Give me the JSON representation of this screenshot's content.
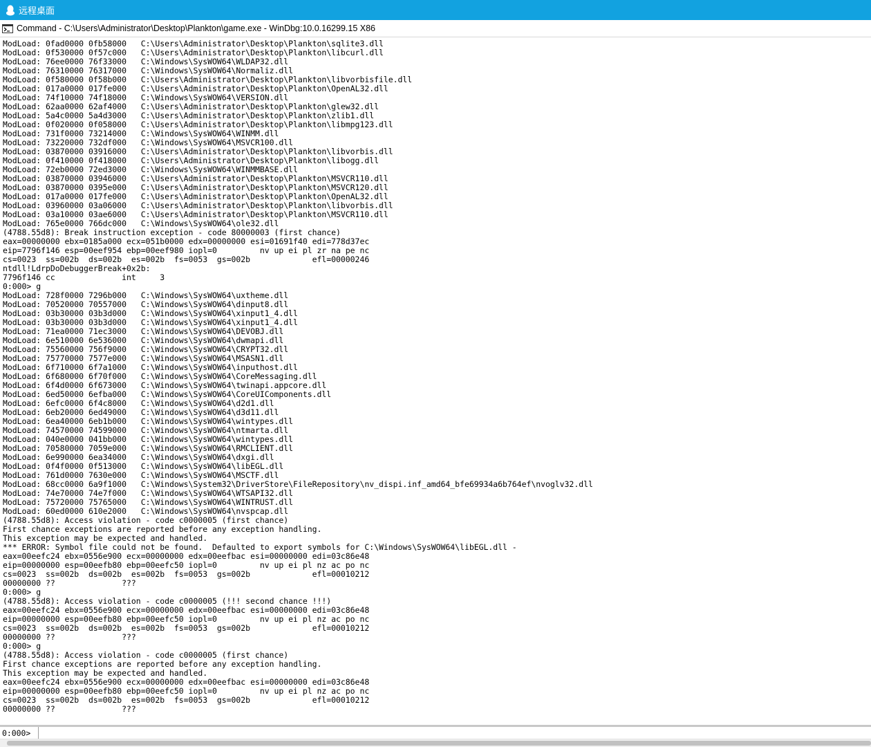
{
  "remote_desktop": {
    "title": "远程桌面"
  },
  "command_window": {
    "title": "Command - C:\\Users\\Administrator\\Desktop\\Plankton\\game.exe - WinDbg:10.0.16299.15 X86"
  },
  "output_lines": [
    "ModLoad: 0fad0000 0fb58000   C:\\Users\\Administrator\\Desktop\\Plankton\\sqlite3.dll",
    "ModLoad: 0f530000 0f57c000   C:\\Users\\Administrator\\Desktop\\Plankton\\libcurl.dll",
    "ModLoad: 76ee0000 76f33000   C:\\Windows\\SysWOW64\\WLDAP32.dll",
    "ModLoad: 76310000 76317000   C:\\Windows\\SysWOW64\\Normaliz.dll",
    "ModLoad: 0f580000 0f58b000   C:\\Users\\Administrator\\Desktop\\Plankton\\libvorbisfile.dll",
    "ModLoad: 017a0000 017fe000   C:\\Users\\Administrator\\Desktop\\Plankton\\OpenAL32.dll",
    "ModLoad: 74f10000 74f18000   C:\\Windows\\SysWOW64\\VERSION.dll",
    "ModLoad: 62aa0000 62af4000   C:\\Users\\Administrator\\Desktop\\Plankton\\glew32.dll",
    "ModLoad: 5a4c0000 5a4d3000   C:\\Users\\Administrator\\Desktop\\Plankton\\zlib1.dll",
    "ModLoad: 0f020000 0f058000   C:\\Users\\Administrator\\Desktop\\Plankton\\libmpg123.dll",
    "ModLoad: 731f0000 73214000   C:\\Windows\\SysWOW64\\WINMM.dll",
    "ModLoad: 73220000 732df000   C:\\Windows\\SysWOW64\\MSVCR100.dll",
    "ModLoad: 03870000 03916000   C:\\Users\\Administrator\\Desktop\\Plankton\\libvorbis.dll",
    "ModLoad: 0f410000 0f418000   C:\\Users\\Administrator\\Desktop\\Plankton\\libogg.dll",
    "ModLoad: 72eb0000 72ed3000   C:\\Windows\\SysWOW64\\WINMMBASE.dll",
    "ModLoad: 03870000 03946000   C:\\Users\\Administrator\\Desktop\\Plankton\\MSVCR110.dll",
    "ModLoad: 03870000 0395e000   C:\\Users\\Administrator\\Desktop\\Plankton\\MSVCR120.dll",
    "ModLoad: 017a0000 017fe000   C:\\Users\\Administrator\\Desktop\\Plankton\\OpenAL32.dll",
    "ModLoad: 03960000 03a06000   C:\\Users\\Administrator\\Desktop\\Plankton\\libvorbis.dll",
    "ModLoad: 03a10000 03ae6000   C:\\Users\\Administrator\\Desktop\\Plankton\\MSVCR110.dll",
    "ModLoad: 765e0000 766dc000   C:\\Windows\\SysWOW64\\ole32.dll",
    "(4788.55d8): Break instruction exception - code 80000003 (first chance)",
    "eax=00000000 ebx=0185a000 ecx=051b0000 edx=00000000 esi=01691f40 edi=778d37ec",
    "eip=7796f146 esp=00eef954 ebp=00eef980 iopl=0         nv up ei pl zr na pe nc",
    "cs=0023  ss=002b  ds=002b  es=002b  fs=0053  gs=002b             efl=00000246",
    "ntdll!LdrpDoDebuggerBreak+0x2b:",
    "7796f146 cc              int     3",
    "0:000> g",
    "ModLoad: 728f0000 7296b000   C:\\Windows\\SysWOW64\\uxtheme.dll",
    "ModLoad: 70520000 70557000   C:\\Windows\\SysWOW64\\dinput8.dll",
    "ModLoad: 03b30000 03b3d000   C:\\Windows\\SysWOW64\\xinput1_4.dll",
    "ModLoad: 03b30000 03b3d000   C:\\Windows\\SysWOW64\\xinput1_4.dll",
    "ModLoad: 71ea0000 71ec3000   C:\\Windows\\SysWOW64\\DEVOBJ.dll",
    "ModLoad: 6e510000 6e536000   C:\\Windows\\SysWOW64\\dwmapi.dll",
    "ModLoad: 75560000 756f9000   C:\\Windows\\SysWOW64\\CRYPT32.dll",
    "ModLoad: 75770000 7577e000   C:\\Windows\\SysWOW64\\MSASN1.dll",
    "ModLoad: 6f710000 6f7a1000   C:\\Windows\\SysWOW64\\inputhost.dll",
    "ModLoad: 6f680000 6f70f000   C:\\Windows\\SysWOW64\\CoreMessaging.dll",
    "ModLoad: 6f4d0000 6f673000   C:\\Windows\\SysWOW64\\twinapi.appcore.dll",
    "ModLoad: 6ed50000 6efba000   C:\\Windows\\SysWOW64\\CoreUIComponents.dll",
    "ModLoad: 6efc0000 6f4c8000   C:\\Windows\\SysWOW64\\d2d1.dll",
    "ModLoad: 6eb20000 6ed49000   C:\\Windows\\SysWOW64\\d3d11.dll",
    "ModLoad: 6ea40000 6eb1b000   C:\\Windows\\SysWOW64\\wintypes.dll",
    "ModLoad: 74570000 74599000   C:\\Windows\\SysWOW64\\ntmarta.dll",
    "ModLoad: 040e0000 041bb000   C:\\Windows\\SysWOW64\\wintypes.dll",
    "ModLoad: 70580000 7059e000   C:\\Windows\\SysWOW64\\RMCLIENT.dll",
    "ModLoad: 6e990000 6ea34000   C:\\Windows\\SysWOW64\\dxgi.dll",
    "ModLoad: 0f4f0000 0f513000   C:\\Windows\\SysWOW64\\libEGL.dll",
    "ModLoad: 761d0000 7630e000   C:\\Windows\\SysWOW64\\MSCTF.dll",
    "ModLoad: 68cc0000 6a9f1000   C:\\Windows\\System32\\DriverStore\\FileRepository\\nv_dispi.inf_amd64_bfe69934a6b764ef\\nvoglv32.dll",
    "ModLoad: 74e70000 74e7f000   C:\\Windows\\SysWOW64\\WTSAPI32.dll",
    "ModLoad: 75720000 75765000   C:\\Windows\\SysWOW64\\WINTRUST.dll",
    "ModLoad: 60ed0000 610e2000   C:\\Windows\\SysWOW64\\nvspcap.dll",
    "(4788.55d8): Access violation - code c0000005 (first chance)",
    "First chance exceptions are reported before any exception handling.",
    "This exception may be expected and handled.",
    "*** ERROR: Symbol file could not be found.  Defaulted to export symbols for C:\\Windows\\SysWOW64\\libEGL.dll -",
    "eax=00eefc24 ebx=0556e900 ecx=00000000 edx=00eefbac esi=00000000 edi=03c86e48",
    "eip=00000000 esp=00eefb80 ebp=00eefc50 iopl=0         nv up ei pl nz ac po nc",
    "cs=0023  ss=002b  ds=002b  es=002b  fs=0053  gs=002b             efl=00010212",
    "00000000 ??              ???",
    "0:000> g",
    "(4788.55d8): Access violation - code c0000005 (!!! second chance !!!)",
    "eax=00eefc24 ebx=0556e900 ecx=00000000 edx=00eefbac esi=00000000 edi=03c86e48",
    "eip=00000000 esp=00eefb80 ebp=00eefc50 iopl=0         nv up ei pl nz ac po nc",
    "cs=0023  ss=002b  ds=002b  es=002b  fs=0053  gs=002b             efl=00010212",
    "00000000 ??              ???",
    "0:000> g",
    "(4788.55d8): Access violation - code c0000005 (first chance)",
    "First chance exceptions are reported before any exception handling.",
    "This exception may be expected and handled.",
    "eax=00eefc24 ebx=0556e900 ecx=00000000 edx=00eefbac esi=00000000 edi=03c86e48",
    "eip=00000000 esp=00eefb80 ebp=00eefc50 iopl=0         nv up ei pl nz ac po nc",
    "cs=0023  ss=002b  ds=002b  es=002b  fs=0053  gs=002b             efl=00010212",
    "00000000 ??              ???"
  ],
  "command_bar": {
    "prompt": "0:000>",
    "input_value": ""
  }
}
